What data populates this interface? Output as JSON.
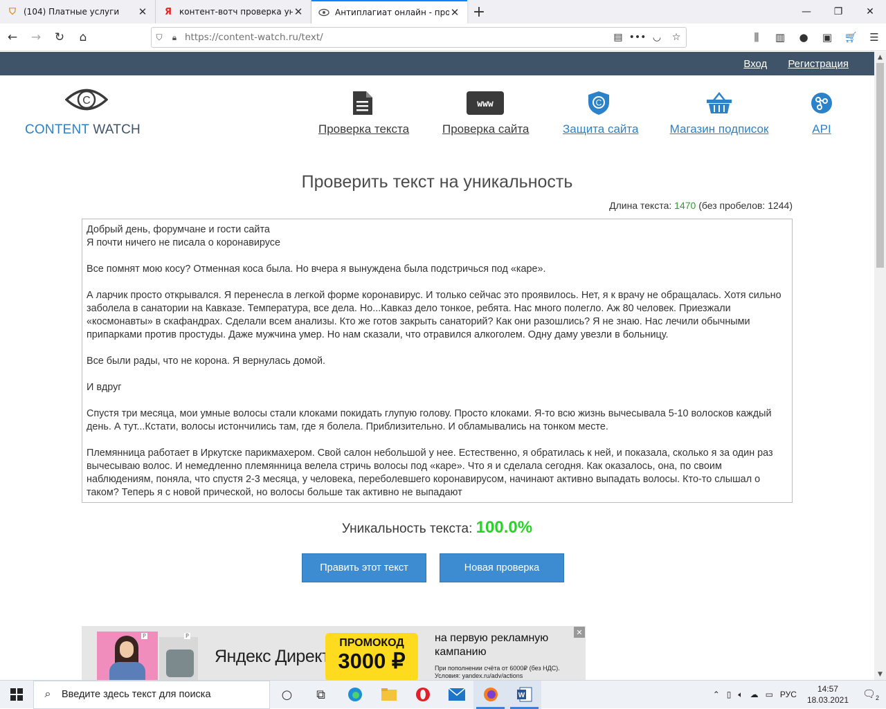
{
  "browser": {
    "tabs": [
      {
        "title": "(104) Платные услуги",
        "favicon": "shield-icon"
      },
      {
        "title": "контент-вотч проверка уника",
        "favicon": "yandex-icon"
      },
      {
        "title": "Антиплагиат онлайн - провер",
        "favicon": "eye-icon"
      }
    ],
    "url_host": "https://content-watch.ru",
    "url_path": "/text/"
  },
  "topstrip": {
    "login": "Вход",
    "register": "Регистрация"
  },
  "logo": {
    "word1": "CONTENT",
    "word2": "WATCH"
  },
  "nav": [
    {
      "label": "Проверка текста",
      "icon": "document-icon"
    },
    {
      "label": "Проверка сайта",
      "icon": "www-icon"
    },
    {
      "label": "Защита сайта",
      "icon": "copyright-shield-icon"
    },
    {
      "label": "Магазин подписок",
      "icon": "basket-icon"
    },
    {
      "label": "API",
      "icon": "api-icon"
    }
  ],
  "main": {
    "title": "Проверить текст на уникальность",
    "length_label": "Длина текста: ",
    "length_value": "1470",
    "length_rest": " (без пробелов: 1244)",
    "text_paragraphs": [
      "Добрый день, форумчане и гости сайта\nЯ почти ничего не писала о коронавирусе",
      "Все помнят мою косу? Отменная коса была. Но вчера я вынуждена была подстричься под «каре».",
      "А ларчик просто открывался. Я перенесла в легкой форме коронавирус. И только сейчас это проявилось. Нет, я к врачу не обращалась. Хотя сильно заболела в санатории на Кавказе. Температура, все дела. Но...Кавказ дело тонкое, ребята. Нас много полегло. Аж 80 человек. Приезжали «космонавты» в скафандрах. Сделали всем анализы. Кто же готов закрыть санаторий? Как они разошлись? Я не знаю. Нас лечили обычными припарками против простуды. Даже мужчина умер. Но нам сказали, что отравился алкоголем. Одну даму увезли в больницу.",
      "Все были рады, что не корона. Я вернулась домой.",
      "И вдруг",
      "Спустя три месяца, мои умные волосы стали клоками покидать глупую голову. Просто клоками. Я-то всю жизнь вычесывала 5-10 волосков каждый день. А тут...Кстати, волосы истончились там, где я болела. Приблизительно. И обламывались на тонком месте.",
      "Племянница работает в Иркутске парикмахером. Свой салон небольшой у нее. Естественно, я обратилась к ней, и показала, сколько я за один раз вычесываю волос. И немедленно племянница велела стричь волосы под «каре». Что я и сделала сегодня. Как оказалось, она, по своим наблюдениям, поняла, что спустя 2-3 месяца, у человека, переболевшего коронавирусом, начинают активно выпадать волосы. Кто-то слышал о таком? Теперь я с новой прической, но волосы больше так активно не выпадают"
    ],
    "uniq_label": "Уникальность текста: ",
    "uniq_value": "100.0%",
    "btn_edit": "Править этот текст",
    "btn_new": "Новая проверка"
  },
  "ad": {
    "brand": "Яндекс Директ",
    "promo_line1": "ПРОМОКОД",
    "promo_line2": "3000 ₽",
    "text": "на первую рекламную кампанию",
    "small1": "При пополнении счёта от 6000₽ (без НДС).",
    "small2": "Условия: yandex.ru/adv/actions",
    "close": "✕",
    "px": "P"
  },
  "taskbar": {
    "search_placeholder": "Введите здесь текст для поиска",
    "lang": "РУС",
    "time": "14:57",
    "date": "18.03.2021",
    "notif_count": "2"
  },
  "colors": {
    "accent_blue": "#2b82c8",
    "strip": "#3f5468",
    "uniq_green": "#2ad12a",
    "button": "#3d8cd1"
  }
}
